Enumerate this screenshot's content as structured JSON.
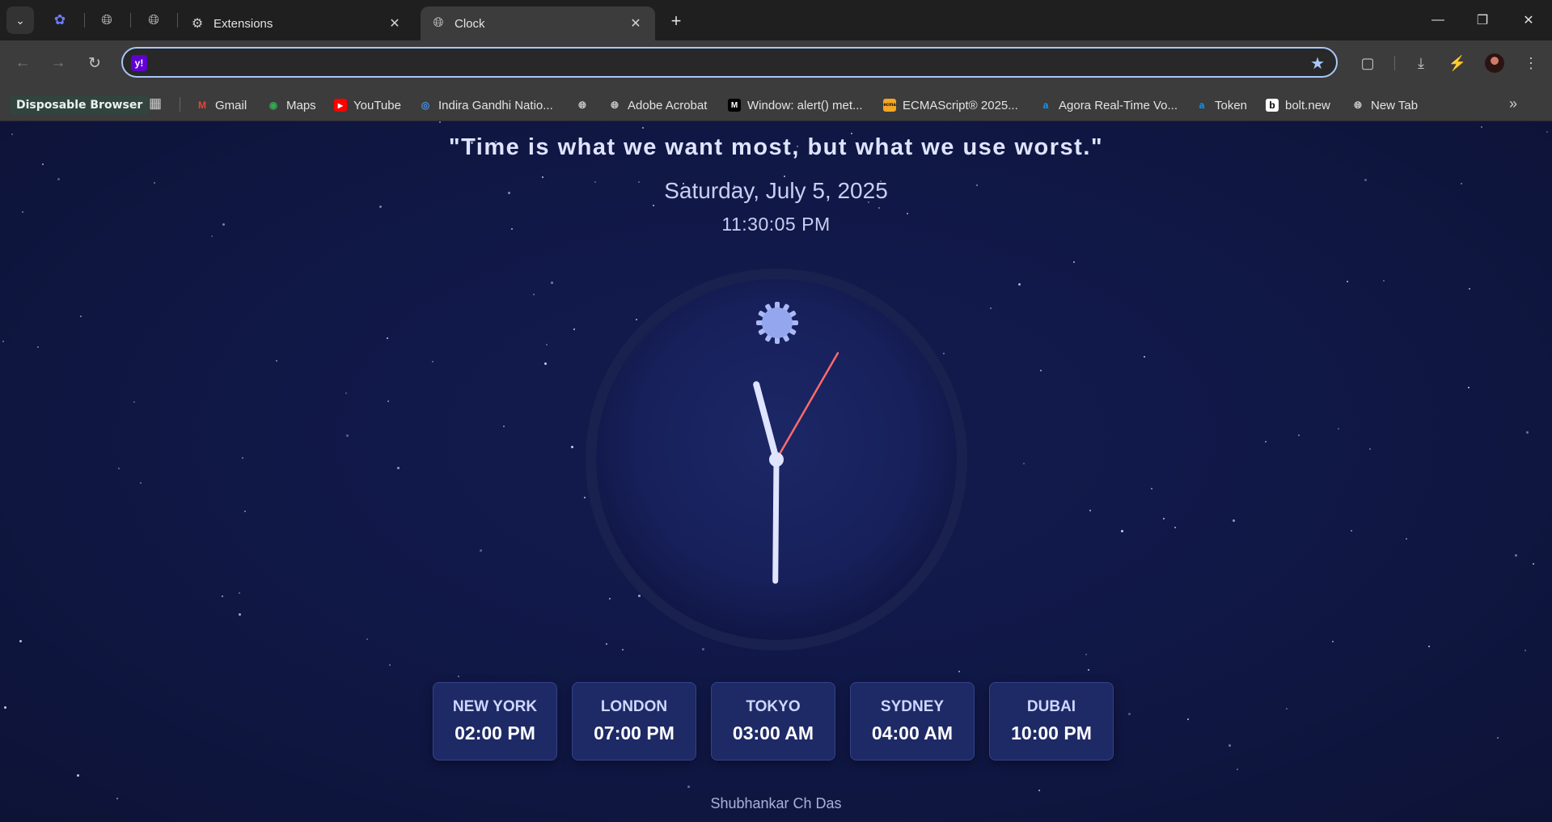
{
  "browser": {
    "tabs": [
      {
        "title": "Extensions",
        "icon": "puzzle-icon",
        "active": false
      },
      {
        "title": "Clock",
        "icon": "globe-icon",
        "active": true
      }
    ],
    "address_value": "",
    "profile_label": "Disposable Browser",
    "bookmarks": [
      {
        "label": "Gmail",
        "icon": "gmail-icon",
        "color": "#ea4335"
      },
      {
        "label": "Maps",
        "icon": "maps-icon",
        "color": "#34a853"
      },
      {
        "label": "YouTube",
        "icon": "youtube-icon",
        "color": "#ff0000"
      },
      {
        "label": "Indira Gandhi Natio...",
        "icon": "emblem-icon",
        "color": "#4a8fe2"
      },
      {
        "label": "",
        "icon": "globe-icon",
        "color": "#cfcfcf"
      },
      {
        "label": "Adobe Acrobat",
        "icon": "globe-icon",
        "color": "#cfcfcf"
      },
      {
        "label": "Window: alert() met...",
        "icon": "mdn-icon",
        "color": "#ffffff"
      },
      {
        "label": "ECMAScript® 2025...",
        "icon": "ecma-icon",
        "color": "#f5a623"
      },
      {
        "label": "Agora Real-Time Vo...",
        "icon": "agora-icon",
        "color": "#099dfd"
      },
      {
        "label": "Token",
        "icon": "agora-icon",
        "color": "#099dfd"
      },
      {
        "label": "bolt.new",
        "icon": "bolt-icon",
        "color": "#ffffff"
      },
      {
        "label": "New Tab",
        "icon": "globe-icon",
        "color": "#cfcfcf"
      }
    ]
  },
  "page": {
    "quote": "\"Time is what we want most, but what we use worst.\"",
    "date": "Saturday, July 5, 2025",
    "time": "11:30:05 PM",
    "clock": {
      "hours": 23,
      "minutes": 30,
      "seconds": 5
    },
    "cities": [
      {
        "name": "NEW YORK",
        "time": "02:00 PM"
      },
      {
        "name": "LONDON",
        "time": "07:00 PM"
      },
      {
        "name": "TOKYO",
        "time": "03:00 AM"
      },
      {
        "name": "SYDNEY",
        "time": "04:00 AM"
      },
      {
        "name": "DUBAI",
        "time": "10:00 PM"
      }
    ],
    "author": "Shubhankar Ch Das"
  },
  "colors": {
    "background": "#0f1538",
    "clock_face": "#17205a",
    "hand": "#dfe4ff",
    "second_hand": "#ff6b6b",
    "accent": "#a8c7fa"
  }
}
